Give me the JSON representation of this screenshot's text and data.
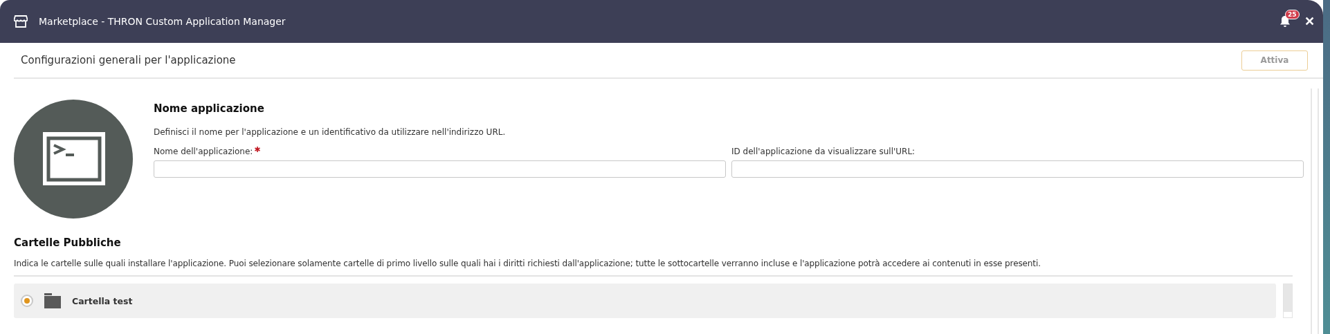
{
  "window": {
    "title": "Marketplace - THRON Custom Application Manager",
    "notification_count": "25",
    "close": "✕"
  },
  "toolbar": {
    "title": "Configurazioni generali per l'applicazione",
    "button": "Attiva"
  },
  "app_name": {
    "heading": "Nome applicazione",
    "description": "Definisci il nome per l'applicazione e un identificativo da utilizzare nell'indirizzo URL.",
    "fields": [
      {
        "label": "Nome dell'applicazione:",
        "required": true
      },
      {
        "label": "ID dell'applicazione da visualizzare sull'URL:",
        "required": false
      }
    ]
  },
  "folders": {
    "heading": "Cartelle Pubbliche",
    "description": "Indica le cartelle sulle quali installare l'applicazione. Puoi selezionare solamente cartelle di primo livello sulle quali hai i diritti richiesti dall'applicazione; tutte le sottocartelle verranno incluse e l'applicazione potrà accedere ai contenuti in esse presenti.",
    "items": [
      {
        "name": "Cartella test",
        "selected": true
      }
    ]
  }
}
